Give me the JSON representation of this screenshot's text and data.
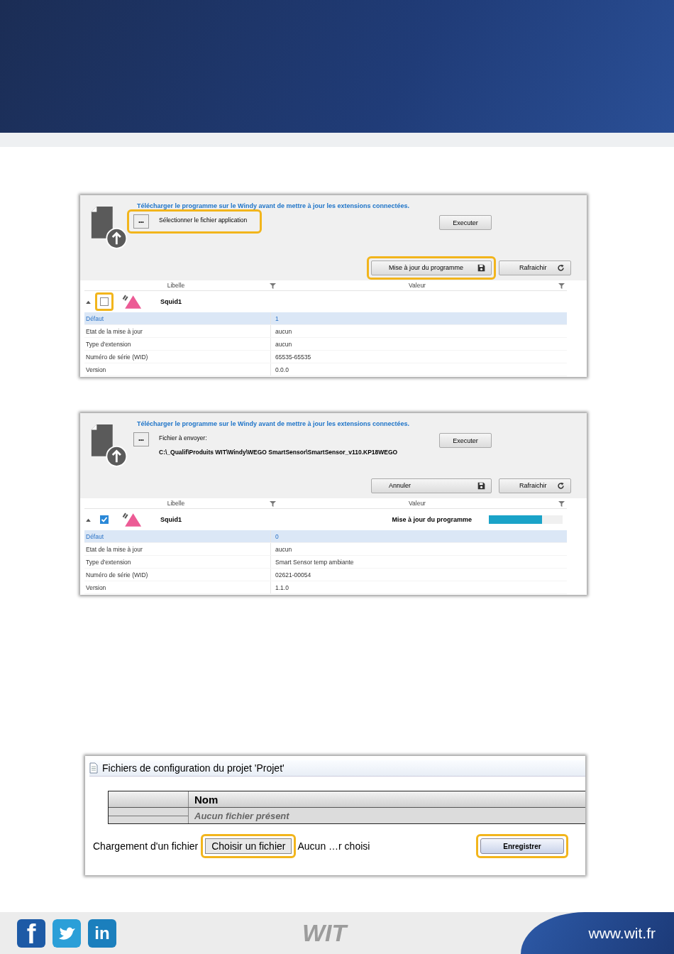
{
  "panels": [
    {
      "kind": "update",
      "notice": "Télécharger le programme sur le Windy avant de mettre à jour les extensions connectées.",
      "file_button": "•••",
      "file_label": "Sélectionner le fichier application",
      "file_highlighted": true,
      "execute_button": "Executer",
      "action_button": "Mise à jour du programme",
      "action_highlighted": true,
      "refresh_button": "Rafraichir",
      "columns": [
        "Libelle",
        "Valeur"
      ],
      "device": {
        "name": "Squid1",
        "expanded": true,
        "checked": false,
        "check_highlighted": true
      },
      "rows": [
        {
          "label": "Défaut",
          "value": "1",
          "selected": true
        },
        {
          "label": "Etat de la mise à jour",
          "value": "aucun",
          "selected": false
        },
        {
          "label": "Type d'extension",
          "value": "aucun",
          "selected": false
        },
        {
          "label": "Numéro de série (WID)",
          "value": "65535-65535",
          "selected": false
        },
        {
          "label": "Version",
          "value": "0.0.0",
          "selected": false
        }
      ]
    },
    {
      "kind": "update",
      "notice": "Télécharger le programme sur le Windy avant de mettre à jour les extensions connectées.",
      "file_button": "•••",
      "file_label": "Fichier à envoyer:",
      "file_path": "C:\\_Qualif\\Produits WIT\\Windy\\WEGO SmartSensor\\SmartSensor_v110.KP18WEGO",
      "execute_button": "Executer",
      "action_button": "Annuler",
      "refresh_button": "Rafraichir",
      "columns": [
        "Libelle",
        "Valeur"
      ],
      "device": {
        "name": "Squid1",
        "expanded": true,
        "checked": true,
        "status": "Mise à jour du programme",
        "level": 0.72
      },
      "rows": [
        {
          "label": "Défaut",
          "value": "0",
          "selected": true
        },
        {
          "label": "Etat de la mise à jour",
          "value": "aucun",
          "selected": false
        },
        {
          "label": "Type d'extension",
          "value": "Smart Sensor temp ambiante",
          "selected": false
        },
        {
          "label": "Numéro de série (WID)",
          "value": "02621-00054",
          "selected": false
        },
        {
          "label": "Version",
          "value": "1.1.0",
          "selected": false
        }
      ]
    },
    {
      "kind": "config",
      "title": "Fichiers de configuration du projet 'Projet'",
      "column": "Nom",
      "empty_text": "Aucun fichier présent",
      "upload_label": "Chargement d'un fichier",
      "choose_button": "Choisir un fichier",
      "choose_highlighted": true,
      "file_status": "Aucun …r choisi",
      "save_button": "Enregistrer",
      "save_highlighted": true
    }
  ],
  "footer": {
    "social": [
      "f",
      "in"
    ],
    "logo": "WIT",
    "url": "www.wit.fr"
  }
}
